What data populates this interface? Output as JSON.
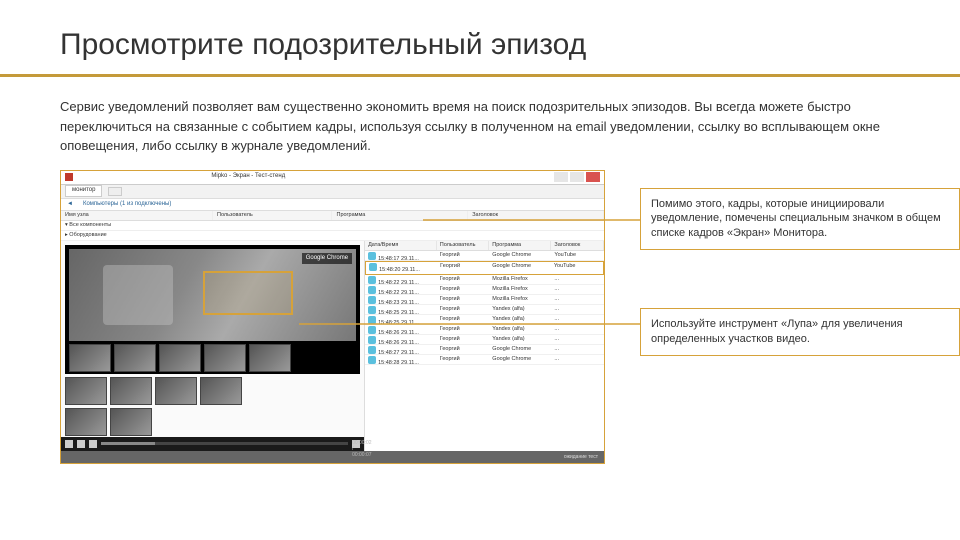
{
  "title": "Просмотрите подозрительный эпизод",
  "intro": "Сервис уведомлений позволяет вам существенно экономить время на поиск подозрительных эпизодов. Вы всегда можете быстро переключиться на связанные с событием кадры, используя ссылку в полученном на email уведомлении, ссылку во всплывающем окне оповещения, либо ссылку в журнале уведомлений.",
  "app": {
    "win_title": "Mipko - Экран - Тест-стенд",
    "toolbar": {
      "t1": "монитор",
      "t2": ""
    },
    "crumb": {
      "a": "◄",
      "b": "Компьютеры (1 из подключены)",
      "c": ""
    },
    "cols": {
      "c1": "Имя узла",
      "c2": "Пользователь",
      "c3": "Программа",
      "c4": "Заголовок"
    },
    "tree": [
      {
        "c1": "▾ Все компоненты",
        "c2": "",
        "c3": "",
        "c4": ""
      },
      {
        "c1": "  ▸ Оборудование",
        "c2": "",
        "c3": "",
        "c4": ""
      }
    ],
    "preview_label": "Google Chrome",
    "loghead": {
      "c1": "Дата/Время",
      "c2": "Пользователь",
      "c3": "Программа",
      "c4": "Заголовок"
    },
    "logrows": [
      {
        "t": "15:48:17 29.11...",
        "u": "Георгий",
        "p": "Google Chrome",
        "w": "YouTube"
      },
      {
        "t": "15:48:20 29.11...",
        "u": "Георгий",
        "p": "Google Chrome",
        "w": "YouTube"
      },
      {
        "t": "15:48:22 29.11...",
        "u": "Георгий",
        "p": "Mozilla Firefox",
        "w": "..."
      },
      {
        "t": "15:48:22 29.11...",
        "u": "Георгий",
        "p": "Mozilla Firefox",
        "w": "..."
      },
      {
        "t": "15:48:23 29.11...",
        "u": "Георгий",
        "p": "Mozilla Firefox",
        "w": "..."
      },
      {
        "t": "15:48:25 29.11...",
        "u": "Георгий",
        "p": "Yandex (alfa)",
        "w": "..."
      },
      {
        "t": "15:48:25 29.11...",
        "u": "Георгий",
        "p": "Yandex (alfa)",
        "w": "..."
      },
      {
        "t": "15:48:26 29.11...",
        "u": "Георгий",
        "p": "Yandex (alfa)",
        "w": "..."
      },
      {
        "t": "15:48:26 29.11...",
        "u": "Георгий",
        "p": "Yandex (alfa)",
        "w": "..."
      },
      {
        "t": "15:48:27 29.11...",
        "u": "Георгий",
        "p": "Google Chrome",
        "w": "..."
      },
      {
        "t": "15:48:28 29.11...",
        "u": "Георгий",
        "p": "Google Chrome",
        "w": "..."
      }
    ],
    "timecode": "00:00:02 / 00:00:07",
    "status": "ожидание  тест"
  },
  "note1": "Помимо этого, кадры, которые инициировали уведомление, помечены специальным значком в общем списке кадров «Экран» Монитора.",
  "note2": "Используйте инструмент «Лупа» для увеличения определенных участков видео."
}
